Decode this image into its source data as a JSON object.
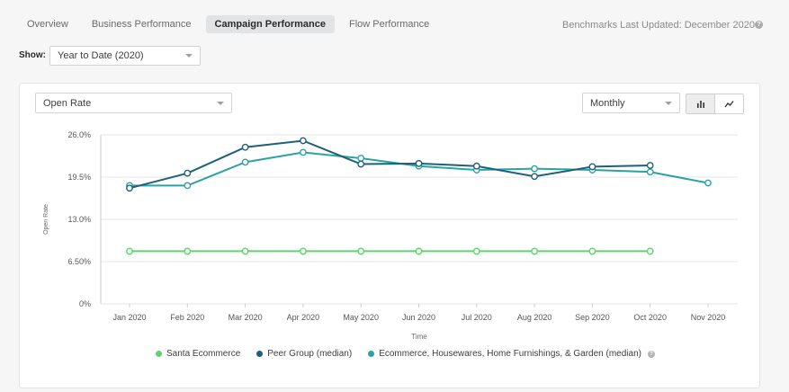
{
  "tabs": [
    {
      "label": "Overview",
      "active": false
    },
    {
      "label": "Business Performance",
      "active": false
    },
    {
      "label": "Campaign Performance",
      "active": true
    },
    {
      "label": "Flow Performance",
      "active": false
    }
  ],
  "benchmarks_label": "Benchmarks Last Updated: December 2020",
  "help_glyph": "?",
  "show": {
    "label": "Show:",
    "value": "Year to Date (2020)"
  },
  "metric_select": {
    "value": "Open Rate"
  },
  "period_select": {
    "value": "Monthly"
  },
  "view_toggle": {
    "options": [
      "bar-chart-icon",
      "line-chart-icon"
    ],
    "selected": "line-chart-icon"
  },
  "colors": {
    "santa": "#5fd36f",
    "peer": "#1f6178",
    "ecommerce": "#2ba3a0",
    "grid": "#e4e4e4"
  },
  "chart_data": {
    "type": "line",
    "xlabel": "Time",
    "ylabel": "Open Rate",
    "categories": [
      "Jan 2020",
      "Feb 2020",
      "Mar 2020",
      "Apr 2020",
      "May 2020",
      "Jun 2020",
      "Jul 2020",
      "Aug 2020",
      "Sep 2020",
      "Oct 2020",
      "Nov 2020"
    ],
    "ylim": [
      0,
      26
    ],
    "yticks": [
      0,
      6.5,
      13,
      19.5,
      26
    ],
    "ytick_labels": [
      "0%",
      "6.50%",
      "13.0%",
      "19.5%",
      "26.0%"
    ],
    "grid": true,
    "legend_position": "bottom",
    "series": [
      {
        "name": "Santa Ecommerce",
        "color_key": "santa",
        "values": [
          8.1,
          8.1,
          8.1,
          8.1,
          8.1,
          8.1,
          8.1,
          8.1,
          8.1,
          8.1,
          null
        ]
      },
      {
        "name": "Peer Group (median)",
        "color_key": "peer",
        "values": [
          17.8,
          20.1,
          24.1,
          25.1,
          21.5,
          21.6,
          21.2,
          19.6,
          21.1,
          21.3,
          null
        ]
      },
      {
        "name": "Ecommerce, Housewares, Home Furnishings, & Garden (median)",
        "color_key": "ecommerce",
        "values": [
          18.2,
          18.2,
          21.8,
          23.3,
          22.4,
          21.2,
          20.6,
          20.8,
          20.6,
          20.3,
          18.6
        ],
        "has_help": true
      }
    ]
  }
}
